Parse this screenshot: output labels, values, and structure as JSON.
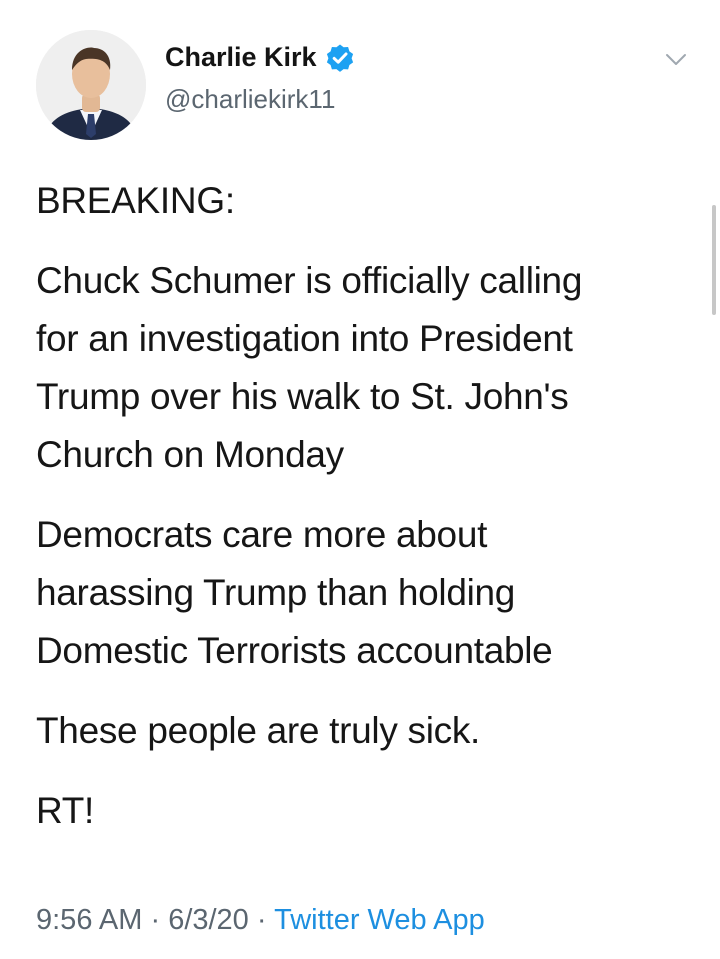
{
  "author": {
    "name": "Charlie Kirk",
    "handle": "@charliekirk11",
    "verified_color": "#1da1f2"
  },
  "icons": {
    "menu": "chevron-down-icon",
    "verified": "verified-badge-icon"
  },
  "tweet": {
    "paragraphs": [
      "BREAKING:",
      "Chuck Schumer is officially calling\nfor an investigation into President\nTrump over his walk to St. John's\nChurch on Monday",
      "Democrats care more about\nharassing Trump than holding\nDomestic Terrorists accountable",
      "These people are truly sick.",
      "RT!"
    ]
  },
  "meta": {
    "time": "9:56 AM",
    "separator": " · ",
    "date": "6/3/20",
    "source": "Twitter Web App"
  }
}
